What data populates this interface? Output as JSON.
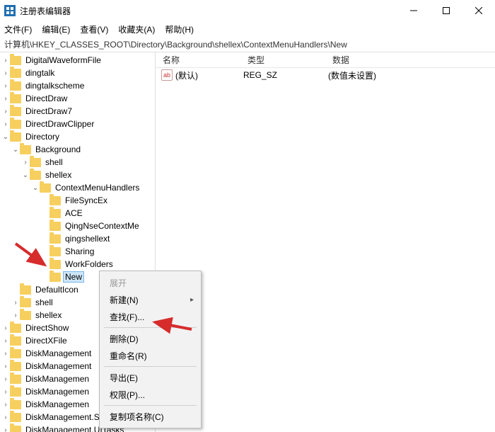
{
  "window": {
    "title": "注册表编辑器"
  },
  "menu": {
    "file": "文件(F)",
    "edit": "编辑(E)",
    "view": "查看(V)",
    "fav": "收藏夹(A)",
    "help": "帮助(H)"
  },
  "path": {
    "prefix": "计算机\\",
    "value": "HKEY_CLASSES_ROOT\\Directory\\Background\\shellex\\ContextMenuHandlers\\New"
  },
  "cols": {
    "name": "名称",
    "type": "类型",
    "data": "数据"
  },
  "row0": {
    "name": "(默认)",
    "type": "REG_SZ",
    "data": "(数值未设置)"
  },
  "tree": {
    "n0": "DigitalWaveformFile",
    "n1": "dingtalk",
    "n2": "dingtalkscheme",
    "n3": "DirectDraw",
    "n4": "DirectDraw7",
    "n5": "DirectDrawClipper",
    "n6": "Directory",
    "n7": "Background",
    "n8": "shell",
    "n9": "shellex",
    "n10": "ContextMenuHandlers",
    "n11": "FileSyncEx",
    "n12": "ACE",
    "n13": "QingNseContextMe",
    "n14": "qingshellext",
    "n15": "Sharing",
    "n16": "WorkFolders",
    "n17": "New",
    "n18": "DefaultIcon",
    "n19": "shell",
    "n20": "shellex",
    "n21": "DirectShow",
    "n22": "DirectXFile",
    "n23": "DiskManagement",
    "n24": "DiskManagement",
    "n25": "DiskManagemen",
    "n26": "DiskManagemen",
    "n27": "DiskManagemen",
    "n28": "DiskManagement.SnapInExtens",
    "n29": "DiskManagement.UITasks"
  },
  "cm": {
    "expand": "展开",
    "new": "新建(N)",
    "find": "查找(F)...",
    "delete": "删除(D)",
    "rename": "重命名(R)",
    "export": "导出(E)",
    "perm": "权限(P)...",
    "copyname": "复制项名称(C)"
  }
}
